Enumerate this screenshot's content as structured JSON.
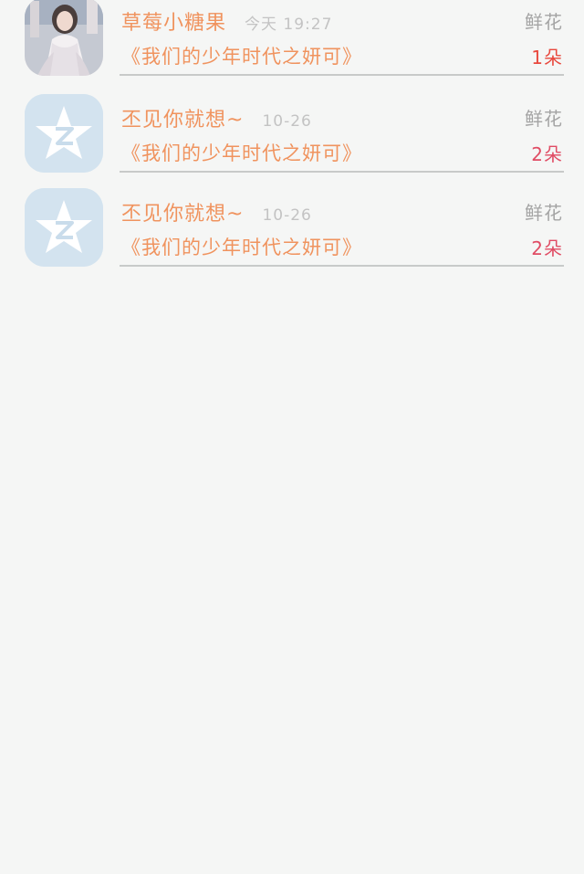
{
  "gifts": [
    {
      "sender": "草莓小糖果",
      "time": "今天 19:27",
      "gift_type": "鲜花",
      "book_title": "《我们的少年时代之妍可》",
      "count": "1朵",
      "avatar": "photo",
      "count_color": "#e8483d"
    },
    {
      "sender": "丕见你就想~",
      "time": "10-26",
      "gift_type": "鲜花",
      "book_title": "《我们的少年时代之妍可》",
      "count": "2朵",
      "avatar": "qq-star-icon",
      "count_color": "#e04c64"
    },
    {
      "sender": "丕见你就想~",
      "time": "10-26",
      "gift_type": "鲜花",
      "book_title": "《我们的少年时代之妍可》",
      "count": "2朵",
      "avatar": "qq-star-icon",
      "count_color": "#e04c64"
    }
  ],
  "colors": {
    "accent_orange": "#f0935e",
    "muted_gray": "#a4a4a4",
    "time_gray": "#c3c3c3",
    "background": "#f5f6f5",
    "qq_avatar_bg": "#d3e3ef"
  }
}
